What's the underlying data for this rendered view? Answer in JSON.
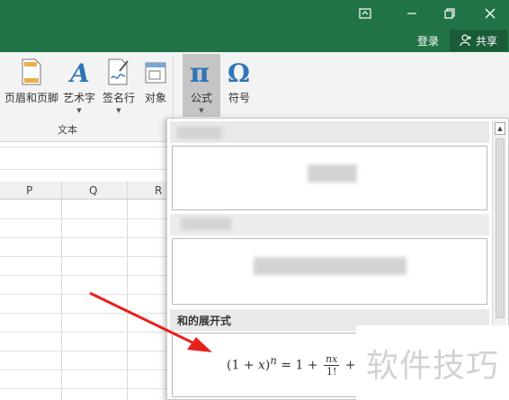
{
  "titlebar": {
    "login": "登录",
    "share": "共享"
  },
  "ribbon": {
    "buttons": [
      {
        "label": "页眉和页脚",
        "icon": "header-footer-icon"
      },
      {
        "label": "艺术字",
        "icon": "wordart-icon"
      },
      {
        "label": "签名行",
        "icon": "signature-line-icon"
      },
      {
        "label": "对象",
        "icon": "object-icon"
      },
      {
        "label": "公式",
        "icon": "pi-equation-icon"
      },
      {
        "label": "符号",
        "icon": "omega-symbol-icon"
      }
    ],
    "group_label": "文本"
  },
  "sheet": {
    "columns": [
      "P",
      "Q",
      "R"
    ]
  },
  "gallery": {
    "section_binomial": "和的展开式"
  },
  "watermark": "软件技巧",
  "colors": {
    "title_green": "#217346",
    "share_green": "#1a5c38",
    "arrow_red": "#e8201d"
  }
}
